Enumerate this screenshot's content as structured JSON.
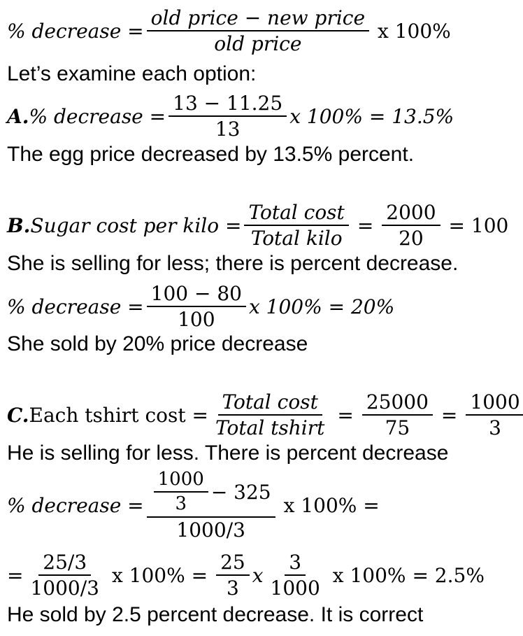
{
  "formula": {
    "lhs": "% decrease =",
    "numerator": "old price − new price",
    "denominator": "old price",
    "tail": "x 100%"
  },
  "intro": "Let’s examine each option:",
  "option_a": {
    "label": "A.",
    "lhs": "% decrease =",
    "numerator": "13 − 11.25",
    "denominator": "13",
    "tail": "x 100% = 13.5%",
    "conclusion": "The egg price decreased by 13.5% percent."
  },
  "option_b": {
    "label": "B.",
    "lhs": "Sugar cost per kilo =",
    "frac1_num": "Total cost",
    "frac1_den": "Total kilo",
    "eq1": "=",
    "frac2_num": "2000",
    "frac2_den": "20",
    "tail": "= 100",
    "note": "She is selling for less; there is percent decrease.",
    "calc_lhs": "% decrease =",
    "calc_num": "100 − 80",
    "calc_den": "100",
    "calc_tail": "x 100% = 20%",
    "conclusion": "She sold by 20% price decrease"
  },
  "option_c": {
    "label": "C.",
    "lhs": "Each tshirt cost =",
    "frac1_num": "Total cost",
    "frac1_den": "Total tshirt",
    "eq1": "=",
    "frac2_num": "25000",
    "frac2_den": "75",
    "eq2": "=",
    "frac3_num": "1000",
    "frac3_den": "3",
    "note": "He is selling for less. There is percent decrease",
    "calc_lhs": "% decrease =",
    "calc_num_frac_num": "1000",
    "calc_num_frac_den": "3",
    "calc_num_rest": "− 325",
    "calc_den": "1000/3",
    "calc_tail": "x 100% =",
    "step_lead": "=",
    "step_frac1_num": "25/3",
    "step_frac1_den": "1000/3",
    "step_mid1": "x 100% =",
    "step_frac2_num": "25",
    "step_frac2_den": "3",
    "step_x": "x",
    "step_frac3_num": "3",
    "step_frac3_den": "1000",
    "step_tail": "x 100% = 2.5%",
    "conclusion": "He sold by 2.5 percent decrease. It is correct"
  }
}
